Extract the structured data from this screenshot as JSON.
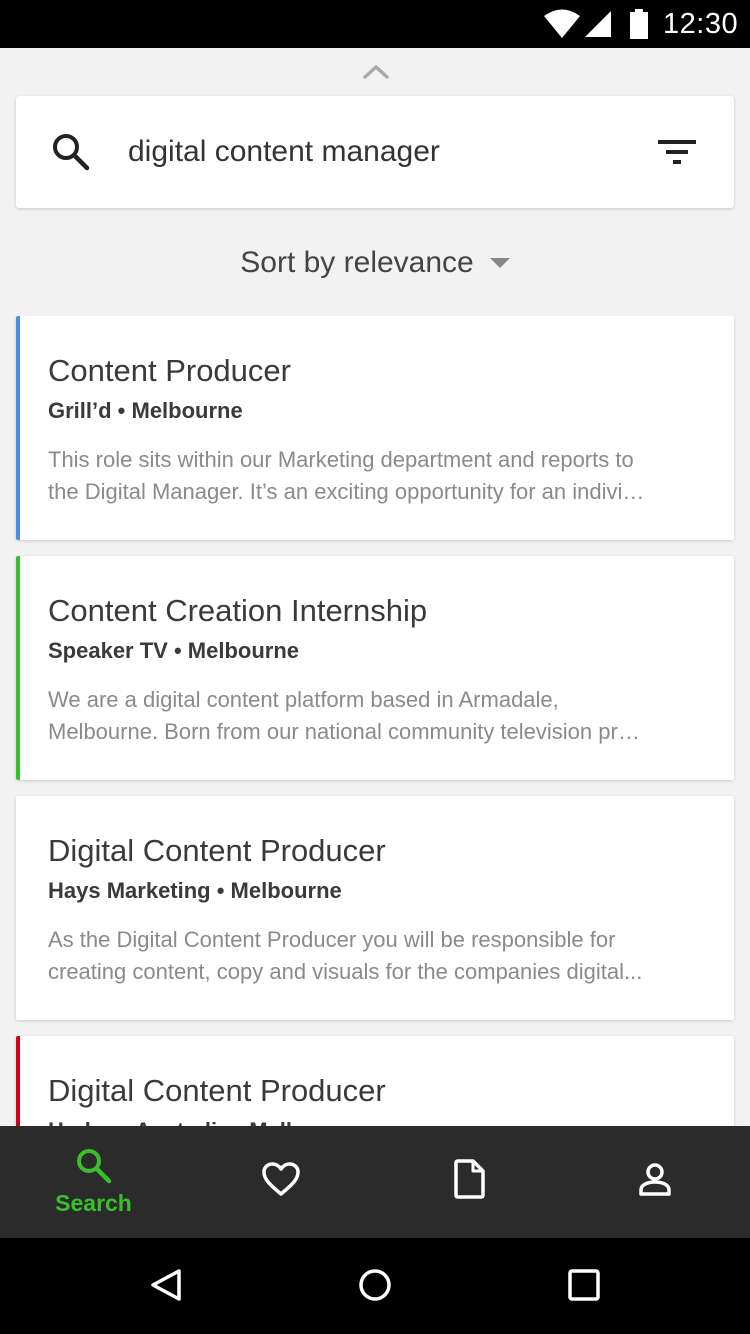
{
  "status_bar": {
    "time": "12:30"
  },
  "search": {
    "query": "digital content manager",
    "icon": "search-icon",
    "filter_icon": "filter-icon"
  },
  "sort": {
    "label": "Sort by relevance"
  },
  "results": [
    {
      "title": "Content Producer",
      "company_location": "Grill’d • Melbourne",
      "snippet_line1": "This role sits within our Marketing department and reports to",
      "snippet_line2": "the Digital Manager. It’s an exciting opportunity for an indivi…",
      "accent_color": "#4a90e2"
    },
    {
      "title": "Content Creation Internship",
      "company_location": "Speaker TV • Melbourne",
      "snippet_line1": "We are a digital content platform based in Armadale,",
      "snippet_line2": "Melbourne. Born from our national community television pr…",
      "accent_color": "#37c02a"
    },
    {
      "title": "Digital Content Producer",
      "company_location": "Hays Marketing • Melbourne",
      "snippet_line1": "As the Digital Content Producer you will be responsible for",
      "snippet_line2": "creating content, copy and visuals for the companies digital...",
      "accent_color": ""
    },
    {
      "title": "Digital Content Producer",
      "company_location": "Hudson Australia • Melbourne",
      "snippet_line1": "",
      "snippet_line2": "",
      "accent_color": "#d0021b"
    }
  ],
  "bottom_nav": {
    "items": [
      {
        "label": "Search",
        "icon": "search-icon",
        "active": true
      },
      {
        "label": "",
        "icon": "heart-icon",
        "active": false
      },
      {
        "label": "",
        "icon": "document-icon",
        "active": false
      },
      {
        "label": "",
        "icon": "profile-icon",
        "active": false
      }
    ],
    "active_color": "#37c02a"
  },
  "system_nav": {
    "icons": [
      "back-icon",
      "home-icon",
      "recents-icon"
    ]
  }
}
